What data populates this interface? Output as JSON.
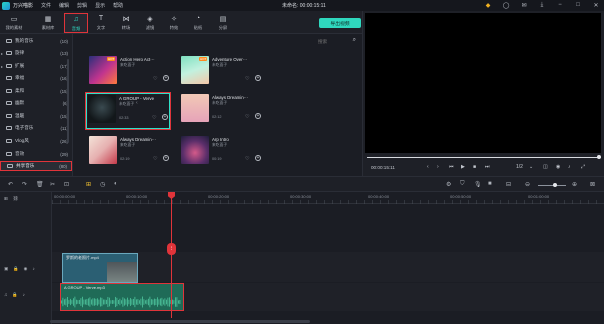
{
  "app": {
    "title": "万兴喵影",
    "project_title": "未命名: 00:00:15:11"
  },
  "menu": [
    "文件",
    "编辑",
    "剪辑",
    "显示",
    "帮助"
  ],
  "toolbar": {
    "tabs": [
      {
        "label": "我的素材",
        "icon": "folder-icon"
      },
      {
        "label": "素材库",
        "icon": "library-icon"
      },
      {
        "label": "音频",
        "icon": "music-note-icon",
        "active": true
      },
      {
        "label": "文字",
        "icon": "text-icon"
      },
      {
        "label": "转场",
        "icon": "transition-icon"
      },
      {
        "label": "滤镜",
        "icon": "filter-icon"
      },
      {
        "label": "特效",
        "icon": "effects-icon"
      },
      {
        "label": "贴纸",
        "icon": "sticker-icon"
      },
      {
        "label": "分屏",
        "icon": "splitscreen-icon"
      }
    ],
    "export_label": "导出视频"
  },
  "folders": [
    {
      "name": "我的音乐",
      "count": "(10)",
      "expandable": false
    },
    {
      "name": "旋律",
      "count": "(13)",
      "expandable": true
    },
    {
      "name": "扩展",
      "count": "(17)",
      "expandable": true
    },
    {
      "name": "幸福",
      "count": "(16)",
      "expandable": false
    },
    {
      "name": "柔和",
      "count": "(15)",
      "expandable": false
    },
    {
      "name": "幽默",
      "count": "(6)",
      "expandable": false
    },
    {
      "name": "温暖",
      "count": "(15)",
      "expandable": false
    },
    {
      "name": "电子音乐",
      "count": "(11)",
      "expandable": false
    },
    {
      "name": "Vlog风",
      "count": "(26)",
      "expandable": false
    },
    {
      "name": "音效",
      "count": "(29)",
      "expandable": false
    },
    {
      "name": "共享音乐",
      "count": "(80)",
      "expandable": false,
      "selected": true
    }
  ],
  "search": {
    "placeholder": "搜索"
  },
  "audio_cards": [
    {
      "title": "Action Hero Act···",
      "artist": "来吃面子",
      "duration": "",
      "hot": "HOT"
    },
    {
      "title": "Adventure Over···",
      "artist": "未吃面子",
      "duration": "",
      "hot": "HOT"
    },
    {
      "title": "A GROUP - Verve",
      "artist": "未吃面子",
      "duration": "02:33",
      "selected": true
    },
    {
      "title": "Always Dreamin···",
      "artist": "未吃面子",
      "duration": "02:12"
    },
    {
      "title": "Always Dreamin···",
      "artist": "来吃面子",
      "duration": "02:19"
    },
    {
      "title": "Arp Intro",
      "artist": "来吃面子",
      "duration": "00:19"
    }
  ],
  "preview": {
    "timecode": "00:00:15:11",
    "playback_fraction": 1.0,
    "ratio": "1/2"
  },
  "timeline": {
    "ruler_labels": [
      "00:00:00:00",
      "00:00:10:00",
      "00:00:20:00",
      "00:00:30:00",
      "00:00:40:00",
      "00:00:50:00",
      "00:01:00:00"
    ],
    "video_clip_label": "罗斯的老照片.mp4",
    "audio_clip_label": "A GROUP - Verve.mp3"
  }
}
